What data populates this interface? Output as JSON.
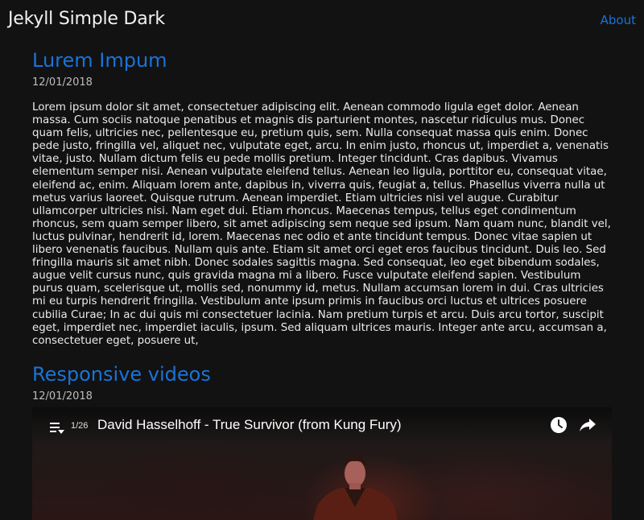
{
  "header": {
    "site_title": "Jekyll Simple Dark",
    "nav_about": "About"
  },
  "posts": [
    {
      "title": "Lurem Impum",
      "date": "12/01/2018",
      "body": "Lorem ipsum dolor sit amet, consectetuer adipiscing elit. Aenean commodo ligula eget dolor. Aenean massa. Cum sociis natoque penatibus et magnis dis parturient montes, nascetur ridiculus mus. Donec quam felis, ultricies nec, pellentesque eu, pretium quis, sem. Nulla consequat massa quis enim. Donec pede justo, fringilla vel, aliquet nec, vulputate eget, arcu. In enim justo, rhoncus ut, imperdiet a, venenatis vitae, justo. Nullam dictum felis eu pede mollis pretium. Integer tincidunt. Cras dapibus. Vivamus elementum semper nisi. Aenean vulputate eleifend tellus. Aenean leo ligula, porttitor eu, consequat vitae, eleifend ac, enim. Aliquam lorem ante, dapibus in, viverra quis, feugiat a, tellus. Phasellus viverra nulla ut metus varius laoreet. Quisque rutrum. Aenean imperdiet. Etiam ultricies nisi vel augue. Curabitur ullamcorper ultricies nisi. Nam eget dui. Etiam rhoncus. Maecenas tempus, tellus eget condimentum rhoncus, sem quam semper libero, sit amet adipiscing sem neque sed ipsum. Nam quam nunc, blandit vel, luctus pulvinar, hendrerit id, lorem. Maecenas nec odio et ante tincidunt tempus. Donec vitae sapien ut libero venenatis faucibus. Nullam quis ante. Etiam sit amet orci eget eros faucibus tincidunt. Duis leo. Sed fringilla mauris sit amet nibh. Donec sodales sagittis magna. Sed consequat, leo eget bibendum sodales, augue velit cursus nunc, quis gravida magna mi a libero. Fusce vulputate eleifend sapien. Vestibulum purus quam, scelerisque ut, mollis sed, nonummy id, metus. Nullam accumsan lorem in dui. Cras ultricies mi eu turpis hendrerit fringilla. Vestibulum ante ipsum primis in faucibus orci luctus et ultrices posuere cubilia Curae; In ac dui quis mi consectetuer lacinia. Nam pretium turpis et arcu. Duis arcu tortor, suscipit eget, imperdiet nec, imperdiet iaculis, ipsum. Sed aliquam ultrices mauris. Integer ante arcu, accumsan a, consectetuer eget, posuere ut,"
    },
    {
      "title": "Responsive videos",
      "date": "12/01/2018"
    }
  ],
  "video": {
    "playlist_count": "1/26",
    "title": "David Hasselhoff - True Survivor (from Kung Fury)",
    "icons": [
      "playlist-icon",
      "clock-icon",
      "share-icon"
    ]
  },
  "colors": {
    "background": "#121212",
    "link": "#1a73d9",
    "text": "#ebebeb"
  }
}
